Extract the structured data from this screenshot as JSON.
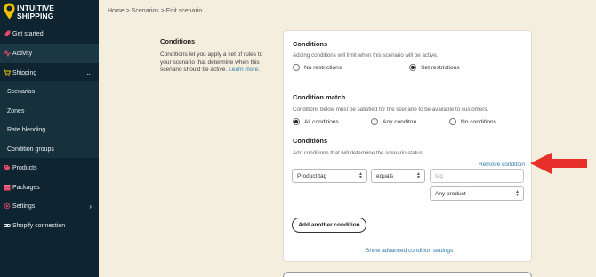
{
  "brand": {
    "line1": "INTUITIVE",
    "line2": "SHIPPING"
  },
  "sidebar": {
    "items": [
      {
        "label": "Get started",
        "icon": "rocket-icon"
      },
      {
        "label": "Activity",
        "icon": "activity-icon"
      },
      {
        "label": "Shipping",
        "icon": "cart-icon"
      },
      {
        "label": "Scenarios"
      },
      {
        "label": "Zones"
      },
      {
        "label": "Rate blending"
      },
      {
        "label": "Condition groups"
      },
      {
        "label": "Products",
        "icon": "tag-icon"
      },
      {
        "label": "Packages",
        "icon": "package-icon"
      },
      {
        "label": "Settings",
        "icon": "gear-icon"
      },
      {
        "label": "Shopify connection",
        "icon": "link-icon"
      }
    ]
  },
  "breadcrumb": "Home > Scenarios > Edit scenario",
  "description": {
    "title": "Conditions",
    "text": "Conditions let you apply a set of rules to your scenario that determine when this scenario should be active.",
    "link": "Learn more."
  },
  "conditions_section": {
    "title": "Conditions",
    "subtitle": "Adding conditions will limit when this scenario will be active.",
    "options": [
      "No restrictions",
      "Set restrictions"
    ],
    "selected": "Set restrictions"
  },
  "match_section": {
    "title": "Condition match",
    "subtitle": "Conditions below must be satisfied for the scenario to be available to customers.",
    "options": [
      "All conditions",
      "Any conditon",
      "No conditions"
    ],
    "selected": "All conditions"
  },
  "rules_section": {
    "title": "Conditions",
    "subtitle": "Add conditions that will determine the scenario status.",
    "remove_link": "Remove condition",
    "field_select": "Product tag",
    "operator_select": "equals",
    "value_placeholder": "tag",
    "product_select": "Any product",
    "add_button": "Add another condition",
    "advanced_link": "Show advanced condition settings"
  },
  "colors": {
    "sidebar": "#0e2430",
    "accent": "#2d7aa5",
    "background": "#f4eedf",
    "arrow": "#e8302a"
  }
}
